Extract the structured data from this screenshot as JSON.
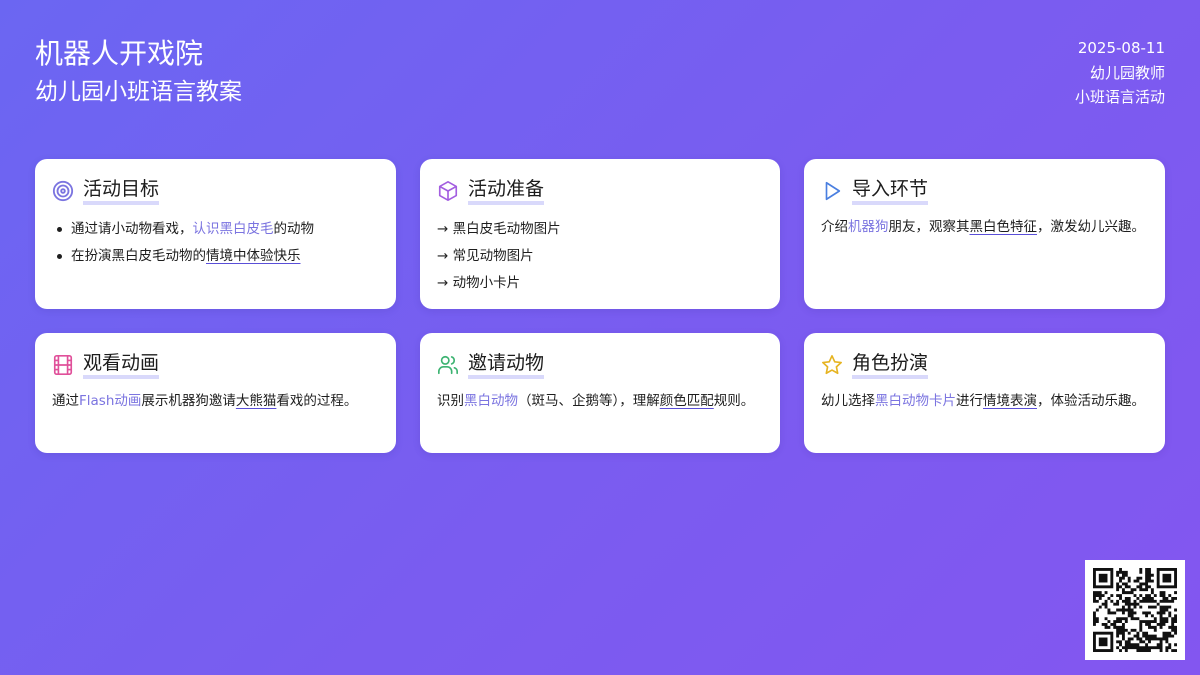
{
  "header": {
    "title": "机器人开戏院",
    "subtitle": "幼儿园小班语言教案",
    "date": "2025-08-11",
    "role": "幼儿园教师",
    "activity": "小班语言活动"
  },
  "cards": [
    {
      "title": "活动目标",
      "icon": "target-icon",
      "icon_color": "#7b74e0",
      "b1": {
        "pre": "通过请小动物看戏，",
        "hl": "认识黑白皮毛",
        "post": "的动物"
      },
      "b2": {
        "pre": "在扮演黑白皮毛动物的",
        "ul": "情境中体验快乐"
      }
    },
    {
      "title": "活动准备",
      "icon": "cube-icon",
      "icon_color": "#a35ee0",
      "items": [
        "→ 黑白皮毛动物图片",
        "→ 常见动物图片",
        "→ 动物小卡片"
      ]
    },
    {
      "title": "导入环节",
      "icon": "play-icon",
      "icon_color": "#4a7fe0",
      "t": {
        "a": "介绍",
        "hl": "机器狗",
        "b": "朋友，观察其",
        "ul": "黑白色特征",
        "c": "，激发幼儿兴趣。"
      }
    },
    {
      "title": "观看动画",
      "icon": "film-icon",
      "icon_color": "#e0509a",
      "t": {
        "a": "通过",
        "hl": "Flash动画",
        "b": "展示机器狗邀请",
        "ul": "大熊猫",
        "c": "看戏的过程。"
      }
    },
    {
      "title": "邀请动物",
      "icon": "users-icon",
      "icon_color": "#3cb371",
      "t": {
        "a": "识别",
        "hl": "黑白动物",
        "b": "（斑马、企鹅等），理解",
        "ul": "颜色匹配",
        "c": "规则。"
      }
    },
    {
      "title": "角色扮演",
      "icon": "star-icon",
      "icon_color": "#e6b422",
      "t": {
        "a": "幼儿选择",
        "hl": "黑白动物卡片",
        "b": "进行",
        "ul": "情境表演",
        "c": "，体验活动乐趣。"
      }
    }
  ],
  "qr": {
    "icon": "qr-code-icon"
  }
}
